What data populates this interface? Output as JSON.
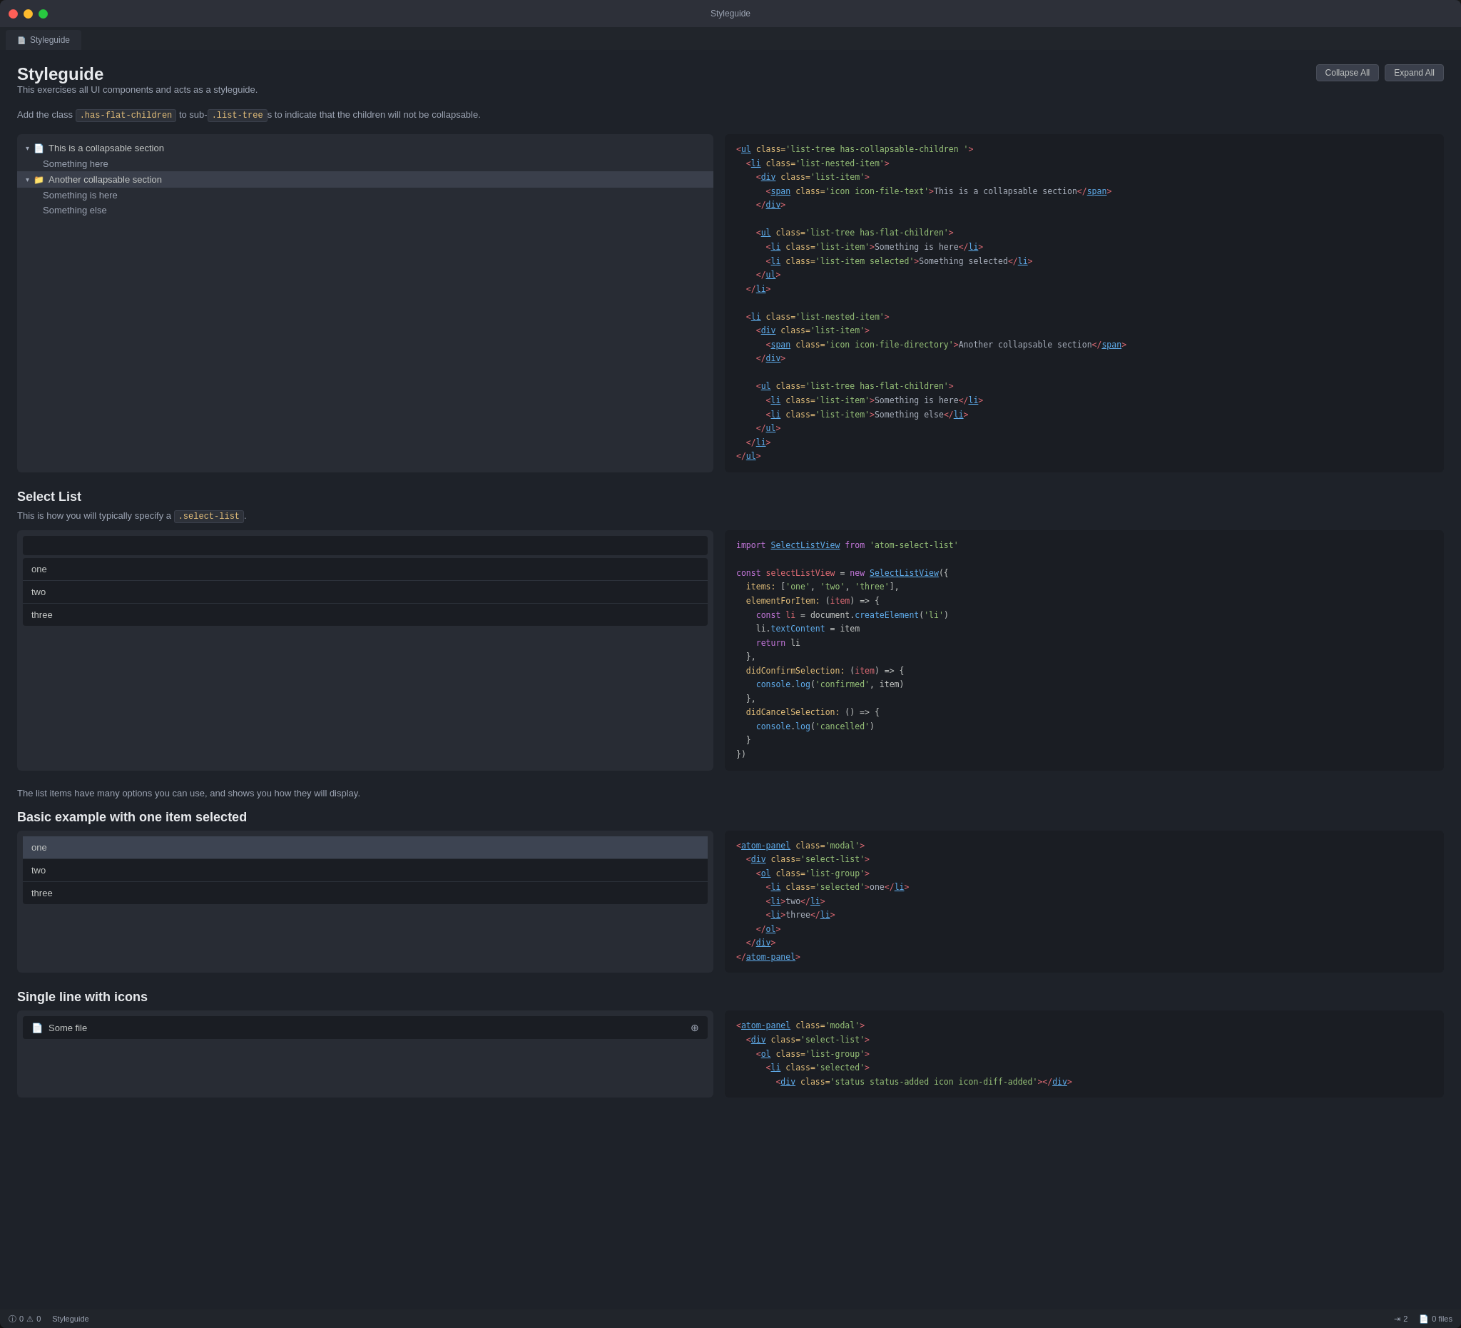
{
  "window": {
    "title": "Styleguide"
  },
  "tab": {
    "label": "Styleguide",
    "icon": "📄"
  },
  "page": {
    "title": "Styleguide",
    "subtitle": "This exercises all UI components and acts as a styleguide.",
    "info_line": "Add the class .has-flat-children to sub-.list-trees to indicate that the children will not be collapsable.",
    "collapse_all": "Collapse All",
    "expand_all": "Expand All"
  },
  "tree_section": {
    "item1_label": "This is a collapsable section",
    "item1_child1": "Something here",
    "item2_label": "Another collapsable section",
    "item2_child1": "Something is here",
    "item2_child2": "Something else"
  },
  "select_list_section": {
    "title": "Select List",
    "desc": "This is how you will typically specify a .select-list.",
    "items": [
      "one",
      "two",
      "three"
    ],
    "footer_desc": "The list items have many options you can use, and shows you how they will display."
  },
  "basic_example_section": {
    "title": "Basic example with one item selected",
    "items": [
      "one",
      "two",
      "three"
    ],
    "selected_item": "one"
  },
  "single_line_section": {
    "title": "Single line with icons",
    "file_name": "Some file",
    "file_icon": "📄"
  },
  "code_block1": {
    "html": "<ul class='list-tree has-collapsable-children '>\n  <li class='list-nested-item'>\n    <div class='list-item'>\n      <span class='icon icon-file-text'>This is a collapsable section</span>\n    </div>\n\n    <ul class='list-tree has-flat-children'>\n      <li class='list-item'>Something is here</li>\n      <li class='list-item selected'>Something selected</li>\n    </ul>\n  </li>\n\n  <li class='list-nested-item'>\n    <div class='list-item'>\n      <span class='icon icon-file-directory'>Another collapsable section</span>\n    </div>\n\n    <ul class='list-tree has-flat-children'>\n      <li class='list-item'>Something is here</li>\n      <li class='list-item'>Something else</li>\n    </ul>\n  </li>\n</ul>"
  },
  "code_block2": {
    "html": "import SelectListView from 'atom-select-list'\n\nconst selectListView = new SelectListView({\n  items: ['one', 'two', 'three'],\n  elementForItem: (item) => {\n    const li = document.createElement('li')\n    li.textContent = item\n    return li\n  },\n  didConfirmSelection: (item) => {\n    console.log('confirmed', item)\n  },\n  didCancelSelection: () => {\n    console.log('cancelled')\n  }\n})"
  },
  "code_block3": {
    "html": "<atom-panel class='modal'>\n  <div class='select-list'>\n    <ol class='list-group'>\n      <li class='selected'>one</li>\n      <li>two</li>\n      <li>three</li>\n    </ol>\n  </div>\n</atom-panel>"
  },
  "code_block4": {
    "html": "<atom-panel class='modal'>\n  <div class='select-list'>\n    <ol class='list-group'>\n      <li class='selected'>\n        <div class='status status-added icon icon-diff-added'></div>"
  },
  "status_bar": {
    "errors": "0",
    "warnings": "0",
    "project": "Styleguide",
    "tab_size": "2",
    "file_count": "0 files"
  }
}
